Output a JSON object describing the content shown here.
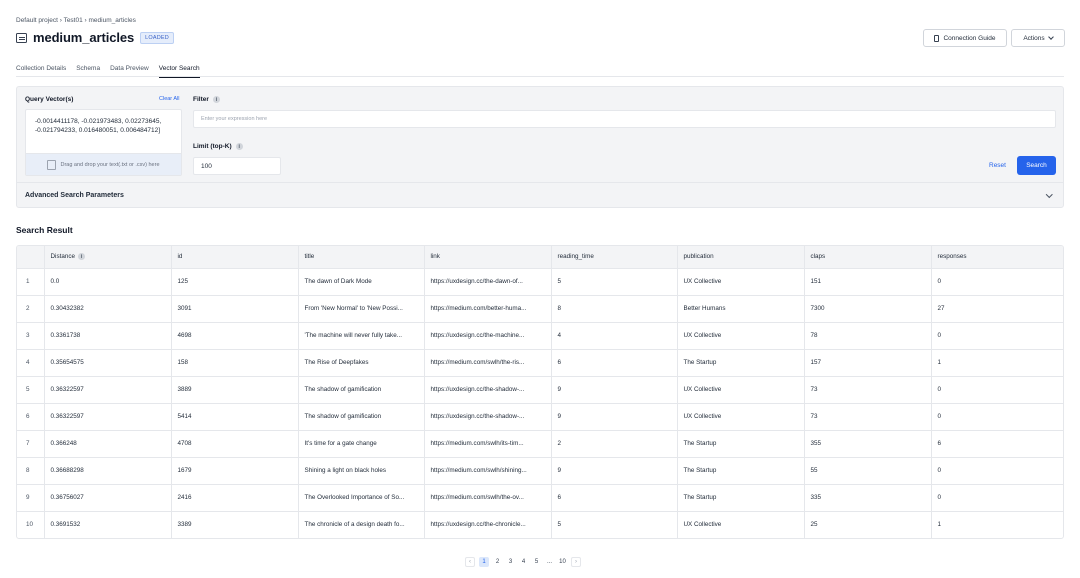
{
  "breadcrumb": "Default project › Test01 › medium_articles",
  "header": {
    "title": "medium_articles",
    "status": "LOADED"
  },
  "actions": {
    "connection_guide": "Connection Guide",
    "actions": "Actions"
  },
  "tabs": [
    "Collection Details",
    "Schema",
    "Data Preview",
    "Vector Search"
  ],
  "active_tab": "Vector Search",
  "query": {
    "label": "Query Vector(s)",
    "clear_all": "Clear All",
    "vector_text": "-0.0014411178, -0.021973483, 0.02273645, -0.021794233, 0.016480051, 0.006484712]",
    "drop_hint": "Drag and drop your text(.txt or .csv) here"
  },
  "filter": {
    "label": "Filter",
    "info": "i",
    "placeholder": "Enter your expression here",
    "value": ""
  },
  "limit": {
    "label": "Limit (top-K)",
    "info": "i",
    "value": "100"
  },
  "buttons": {
    "reset": "Reset",
    "search": "Search"
  },
  "advanced": {
    "label": "Advanced Search Parameters"
  },
  "results": {
    "title": "Search Result",
    "columns": [
      "",
      "Distance",
      "id",
      "title",
      "link",
      "reading_time",
      "publication",
      "claps",
      "responses"
    ],
    "distance_info": "i",
    "rows": [
      [
        "1",
        "0.0",
        "125",
        "The dawn of Dark Mode",
        "https://uxdesign.cc/the-dawn-of...",
        "5",
        "UX Collective",
        "151",
        "0"
      ],
      [
        "2",
        "0.30432382",
        "3091",
        "From 'New Normal' to 'New Possi...",
        "https://medium.com/better-huma...",
        "8",
        "Better Humans",
        "7300",
        "27"
      ],
      [
        "3",
        "0.3361738",
        "4698",
        "'The machine will never fully take...",
        "https://uxdesign.cc/the-machine...",
        "4",
        "UX Collective",
        "78",
        "0"
      ],
      [
        "4",
        "0.35654575",
        "158",
        "The Rise of Deepfakes",
        "https://medium.com/swlh/the-ris...",
        "6",
        "The Startup",
        "157",
        "1"
      ],
      [
        "5",
        "0.36322597",
        "3889",
        "The shadow of gamification",
        "https://uxdesign.cc/the-shadow-...",
        "9",
        "UX Collective",
        "73",
        "0"
      ],
      [
        "6",
        "0.36322597",
        "5414",
        "The shadow of gamification",
        "https://uxdesign.cc/the-shadow-...",
        "9",
        "UX Collective",
        "73",
        "0"
      ],
      [
        "7",
        "0.366248",
        "4708",
        "It's time for a gate change",
        "https://medium.com/swlh/its-tim...",
        "2",
        "The Startup",
        "355",
        "6"
      ],
      [
        "8",
        "0.36688298",
        "1679",
        "Shining a light on black holes",
        "https://medium.com/swlh/shining...",
        "9",
        "The Startup",
        "55",
        "0"
      ],
      [
        "9",
        "0.36756027",
        "2416",
        "The Overlooked Importance of So...",
        "https://medium.com/swlh/the-ov...",
        "6",
        "The Startup",
        "335",
        "0"
      ],
      [
        "10",
        "0.3691532",
        "3389",
        "The chronicle of a design death fo...",
        "https://uxdesign.cc/the-chronicle...",
        "5",
        "UX Collective",
        "25",
        "1"
      ]
    ]
  },
  "pagination": {
    "prev": "‹",
    "next": "›",
    "pages": [
      "1",
      "2",
      "3",
      "4",
      "5",
      "...",
      "10"
    ],
    "current": "1"
  },
  "colors": {
    "accent": "#2563eb",
    "badge_bg": "#e5edfb",
    "panel_bg": "#f3f4f6"
  }
}
